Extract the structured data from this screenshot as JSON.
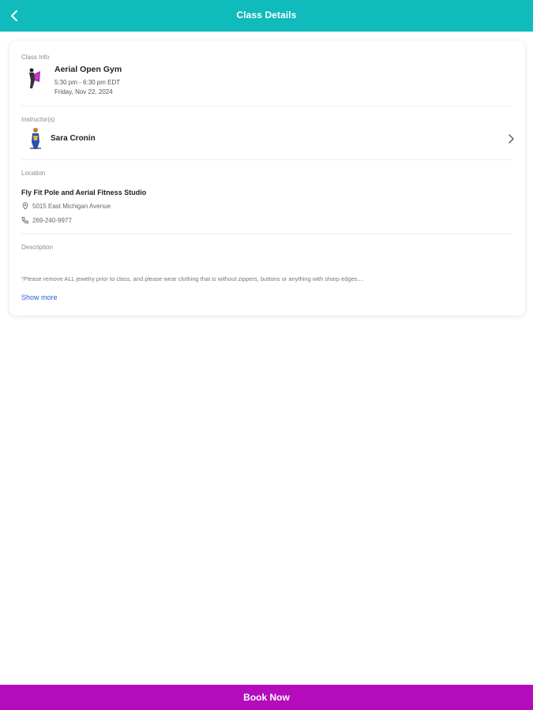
{
  "colors": {
    "header_bg": "#10bbbb",
    "book_bg": "#b40cbd",
    "link": "#2a5bd7"
  },
  "header": {
    "title": "Class Details",
    "back_icon": "chevron-left-icon"
  },
  "class_info": {
    "section_label": "Class Info",
    "title": "Aerial Open Gym",
    "time": "5:30 pm - 6:30 pm EDT",
    "date": "Friday, Nov 22, 2024"
  },
  "instructors": {
    "section_label": "Instructor(s)",
    "name": "Sara Cronin",
    "chevron_icon": "chevron-right-icon"
  },
  "location": {
    "section_label": "Location",
    "studio_name": "Fly Fit Pole and Aerial Fitness Studio",
    "address": "5015 East Michigan Avenue",
    "phone": "269-240-9977",
    "address_icon": "map-pin-icon",
    "phone_icon": "phone-icon"
  },
  "description": {
    "section_label": "Description",
    "text": "\"Please remove ALL jewelry prior to class, and please wear clothing that is without zippers, buttons or anything with sharp edges....",
    "show_more_label": "Show more"
  },
  "footer": {
    "book_label": "Book Now"
  }
}
